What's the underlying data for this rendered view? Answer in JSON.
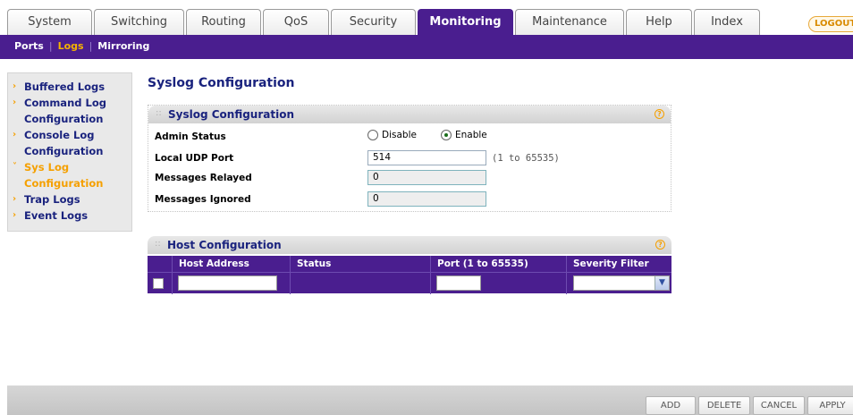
{
  "top_tabs": [
    {
      "label": "System"
    },
    {
      "label": "Switching"
    },
    {
      "label": "Routing"
    },
    {
      "label": "QoS"
    },
    {
      "label": "Security"
    },
    {
      "label": "Monitoring",
      "active": true
    },
    {
      "label": "Maintenance"
    },
    {
      "label": "Help"
    },
    {
      "label": "Index"
    }
  ],
  "logout_label": "LOGOUT",
  "sub_nav": [
    {
      "label": "Ports"
    },
    {
      "label": "Logs",
      "active": true
    },
    {
      "label": "Mirroring"
    }
  ],
  "left_nav": [
    {
      "label": "Buffered Logs"
    },
    {
      "label": "Command Log Configuration"
    },
    {
      "label": "Console Log Configuration"
    },
    {
      "label": "Sys Log Configuration",
      "active": true
    },
    {
      "label": "Trap Logs"
    },
    {
      "label": "Event Logs"
    }
  ],
  "page_title": "Syslog Configuration",
  "syslog_panel": {
    "title": "Syslog Configuration",
    "admin_status_label": "Admin Status",
    "admin_status_options": [
      "Disable",
      "Enable"
    ],
    "admin_status_selected": "Enable",
    "udp_port_label": "Local UDP Port",
    "udp_port_value": "514",
    "udp_port_hint": "(1 to 65535)",
    "relayed_label": "Messages Relayed",
    "relayed_value": "0",
    "ignored_label": "Messages Ignored",
    "ignored_value": "0"
  },
  "host_panel": {
    "title": "Host Configuration",
    "columns": [
      "Host Address",
      "Status",
      "Port (1 to 65535)",
      "Severity Filter"
    ],
    "row": {
      "host_address": "",
      "status": "",
      "port": "",
      "severity": ""
    }
  },
  "actions": [
    "ADD",
    "DELETE",
    "CANCEL",
    "APPLY"
  ],
  "colors": {
    "brand_purple": "#4a1e8f",
    "accent_orange": "#f5a000",
    "nav_blue": "#1a237e"
  }
}
